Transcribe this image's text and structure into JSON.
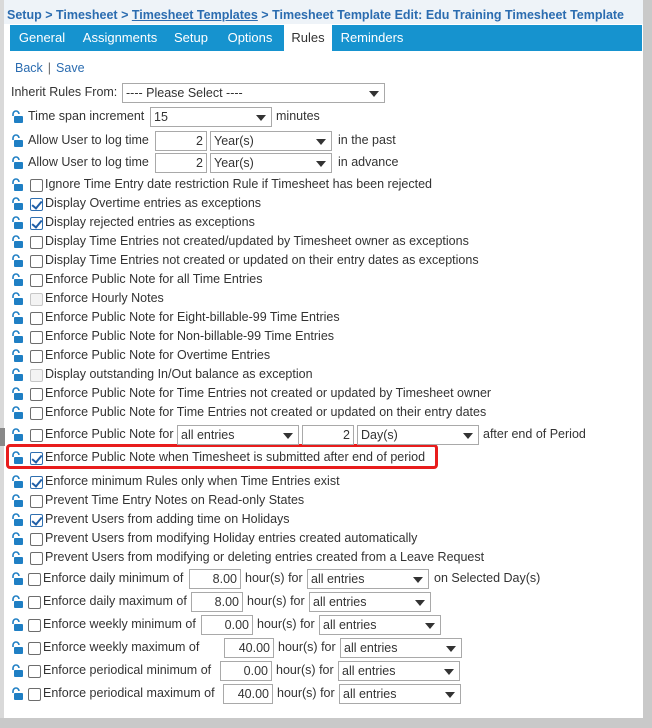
{
  "breadcrumb": {
    "setup": "Setup",
    "sep1": " > ",
    "timesheet": "Timesheet",
    "sep2": " > ",
    "templates": "Timesheet Templates",
    "sep3": " > ",
    "current": "Timesheet Template Edit: Edu Training Timesheet Template"
  },
  "tabs": [
    "General",
    "Assignments",
    "Setup",
    "Options",
    "Rules",
    "Reminders"
  ],
  "active_tab": "Rules",
  "actions": {
    "back": "Back",
    "pipe": "|",
    "save": "Save"
  },
  "inherit": {
    "label": "Inherit Rules From:",
    "value": "---- Please Select ----"
  },
  "time_span": {
    "label": "Time span increment",
    "value": "15",
    "unit": "minutes"
  },
  "log_past": {
    "label": "Allow User to log time",
    "number": "2",
    "unit": "Year(s)",
    "suffix": "in the past"
  },
  "log_advance": {
    "label": "Allow User to log time",
    "number": "2",
    "unit": "Year(s)",
    "suffix": "in advance"
  },
  "rules": [
    {
      "label": "Ignore Time Entry date restriction Rule if Timesheet has been rejected",
      "checked": false
    },
    {
      "label": "Display Overtime entries as exceptions",
      "checked": true
    },
    {
      "label": "Display rejected entries as exceptions",
      "checked": true
    },
    {
      "label": "Display Time Entries not created/updated by Timesheet owner as exceptions",
      "checked": false
    },
    {
      "label": "Display Time Entries not created or updated on their entry dates as exceptions",
      "checked": false
    },
    {
      "label": "Enforce Public Note for all Time Entries",
      "checked": false
    },
    {
      "label": "Enforce Hourly Notes",
      "checked": false,
      "disabled": true
    },
    {
      "label": "Enforce Public Note for Eight-billable-99 Time Entries",
      "checked": false
    },
    {
      "label": "Enforce Public Note for Non-billable-99 Time Entries",
      "checked": false
    },
    {
      "label": "Enforce Public Note for Overtime Entries",
      "checked": false
    },
    {
      "label": "Display outstanding In/Out balance as exception",
      "checked": false,
      "disabled": true
    },
    {
      "label": "Enforce Public Note for Time Entries not created or updated by Timesheet owner",
      "checked": false
    },
    {
      "label": "Enforce Public Note for Time Entries not created or updated on their entry dates",
      "checked": false
    }
  ],
  "after_period": {
    "label": "Enforce Public Note for",
    "scope": "all entries",
    "number": "2",
    "unit": "Day(s)",
    "suffix": "after end of Period"
  },
  "rules2": [
    {
      "label": "Enforce Public Note when Timesheet is submitted after end of period",
      "checked": true
    },
    {
      "label": "Enforce minimum Rules only when Time Entries exist",
      "checked": true
    },
    {
      "label": "Prevent Time Entry Notes on Read-only States",
      "checked": false
    },
    {
      "label": "Prevent Users from adding time on Holidays",
      "checked": true
    },
    {
      "label": "Prevent Users from modifying Holiday entries created automatically",
      "checked": false
    },
    {
      "label": "Prevent Users from modifying or deleting entries created from a Leave Request",
      "checked": false
    }
  ],
  "hours_rules": [
    {
      "label": "Enforce daily minimum of",
      "value": "8.00",
      "unit": "hour(s) for",
      "scope": "all entries",
      "suffix": "on Selected Day(s)"
    },
    {
      "label": "Enforce daily maximum of",
      "value": "8.00",
      "unit": "hour(s) for",
      "scope": "all entries",
      "suffix": ""
    },
    {
      "label": "Enforce weekly minimum of",
      "value": "0.00",
      "unit": "hour(s) for",
      "scope": "all entries",
      "suffix": ""
    },
    {
      "label": "Enforce weekly maximum of",
      "value": "40.00",
      "unit": "hour(s) for",
      "scope": "all entries",
      "suffix": ""
    },
    {
      "label": "Enforce periodical minimum of",
      "value": "0.00",
      "unit": "hour(s) for",
      "scope": "all entries",
      "suffix": ""
    },
    {
      "label": "Enforce periodical maximum of",
      "value": "40.00",
      "unit": "hour(s) for",
      "scope": "all entries",
      "suffix": ""
    }
  ],
  "colors": {
    "accent": "#1693cf",
    "link": "#2b6cb0",
    "highlight": "#e81c1c",
    "lock": "#1f7fc4"
  }
}
